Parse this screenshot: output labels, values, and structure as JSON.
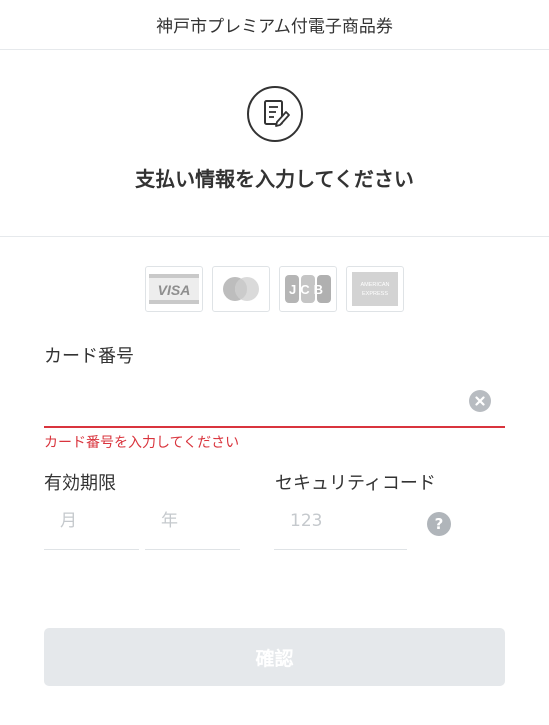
{
  "header": {
    "title": "神戸市プレミアム付電子商品券"
  },
  "intro": {
    "icon": "document-edit-icon",
    "title": "支払い情報を入力してください"
  },
  "card_brands": [
    {
      "name": "visa-logo",
      "text": "VISA"
    },
    {
      "name": "mastercard-logo",
      "text": ""
    },
    {
      "name": "jcb-logo",
      "text": "JCB"
    },
    {
      "name": "amex-logo",
      "text": "AMERICAN EXPRESS"
    }
  ],
  "card_number": {
    "label": "カード番号",
    "value": "",
    "placeholder": "",
    "error": "カード番号を入力してください"
  },
  "expiry": {
    "label": "有効期限",
    "month_placeholder": "月",
    "year_placeholder": "年"
  },
  "security_code": {
    "label": "セキュリティコード",
    "placeholder": "123",
    "help": "?"
  },
  "confirm": {
    "label": "確認"
  },
  "colors": {
    "error": "#d9343d",
    "disabled_button": "#e5e8eb",
    "divider": "#e6e9ec",
    "icon_gray": "#b8bcc1"
  }
}
